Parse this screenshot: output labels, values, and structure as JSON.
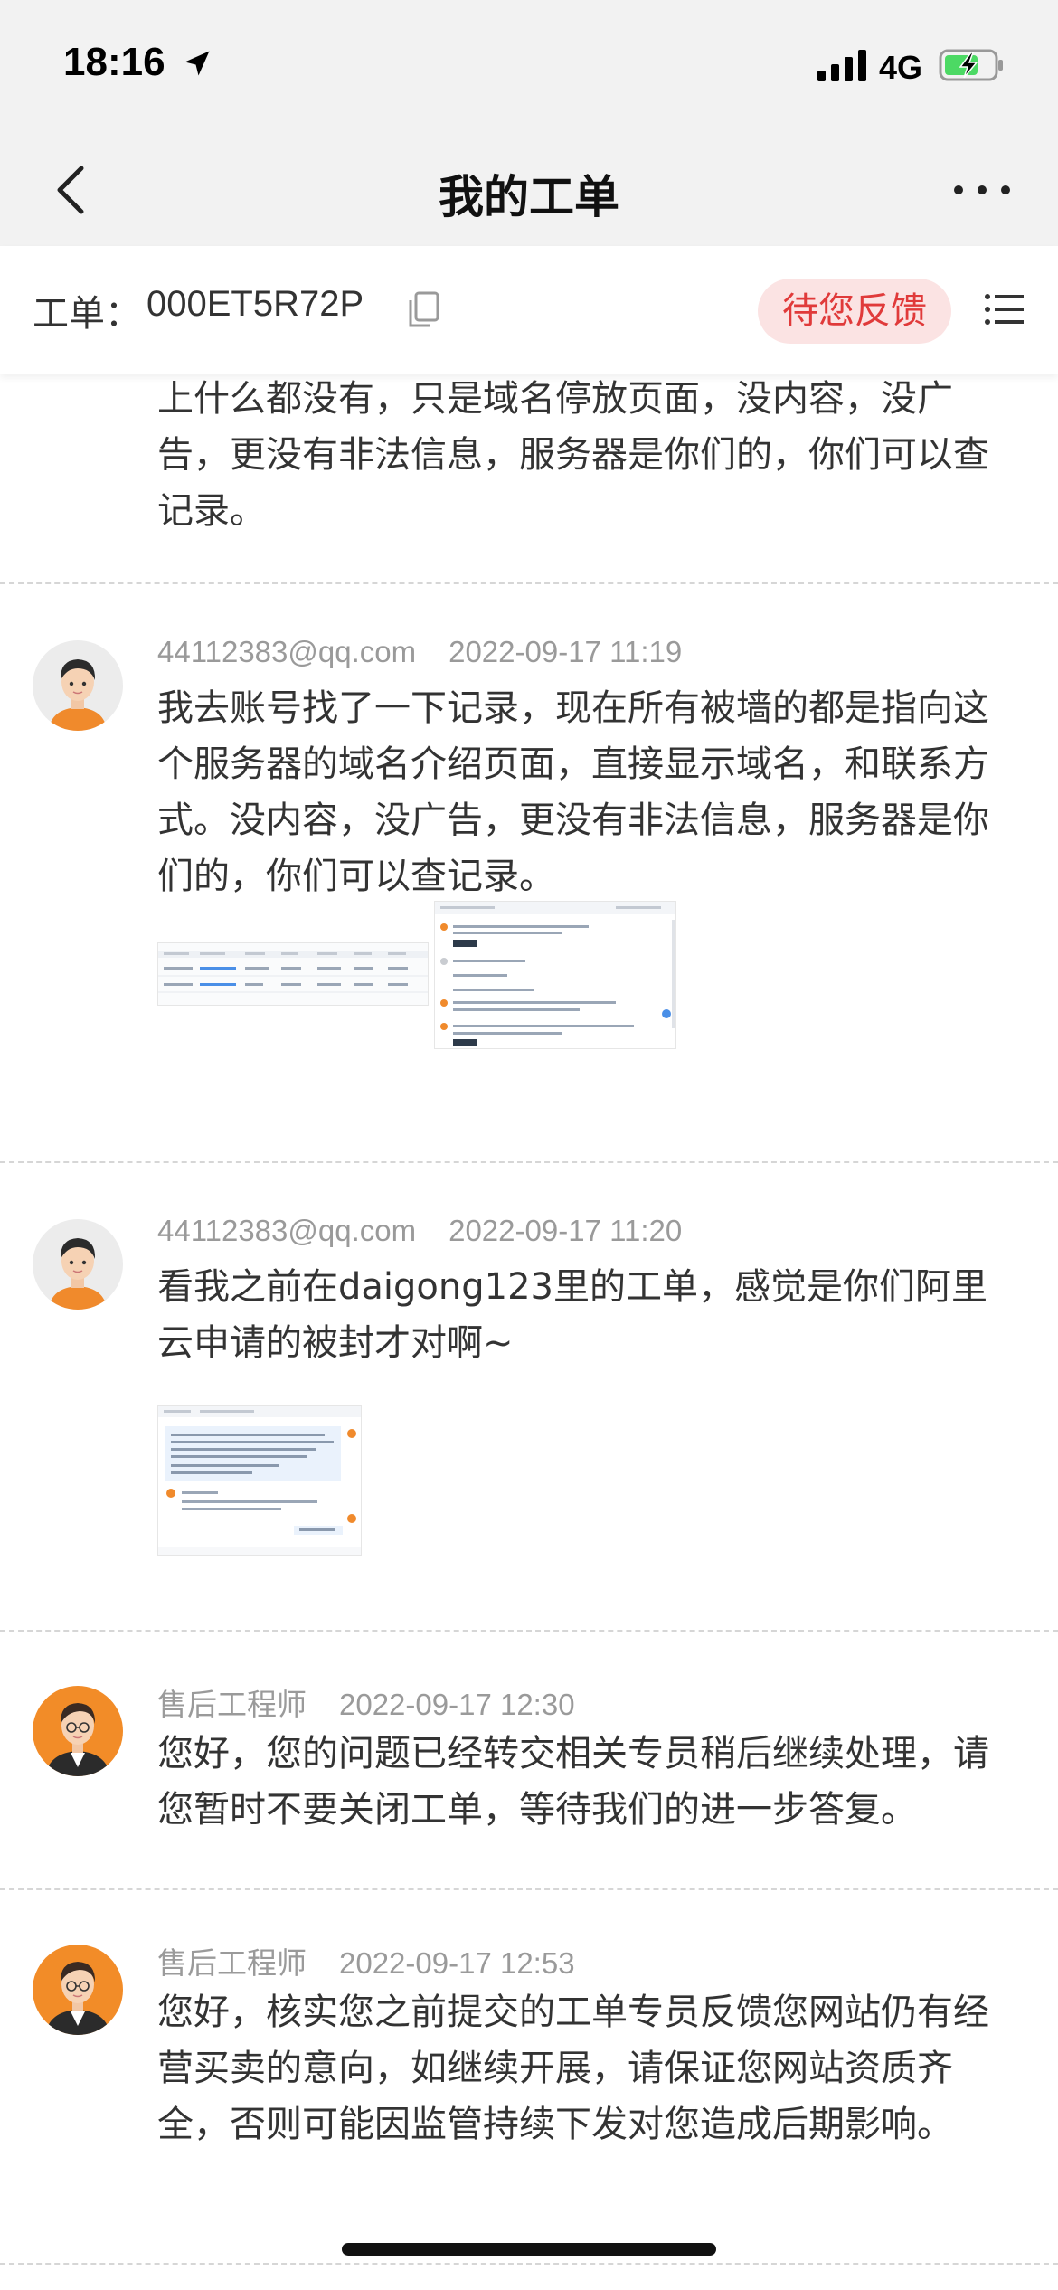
{
  "status_bar": {
    "time": "18:16",
    "network": "4G",
    "icons": [
      "location-arrow-icon",
      "signal-icon",
      "battery-charging-icon"
    ],
    "battery_color": "#4cd964"
  },
  "nav": {
    "title": "我的工单",
    "back_icon": "chevron-left-icon",
    "more_icon": "more-icon"
  },
  "ticket": {
    "label": "工单：",
    "id": "000ET5R72P",
    "status": "待您反馈",
    "status_color": "#e03a3a",
    "copy_icon": "copy-icon",
    "list_icon": "list-icon"
  },
  "messages": [
    {
      "partial": true,
      "body": "上什么都没有，只是域名停放页面，没内容，没广告，更没有非法信息，服务器是你们的，你们可以查记录。"
    },
    {
      "sender": "44112383@qq.com",
      "time": "2022-09-17 11:19",
      "avatar": "user-avatar",
      "body": "我去账号找了一下记录，现在所有被墙的都是指向这个服务器的域名介绍页面，直接显示域名，和联系方式。没内容，没广告，更没有非法信息，服务器是你们的，你们可以查记录。",
      "attachments": [
        "screenshot-thumbnail-table",
        "screenshot-thumbnail-chat"
      ]
    },
    {
      "sender": "44112383@qq.com",
      "time": "2022-09-17 11:20",
      "avatar": "user-avatar",
      "body": "看我之前在daigong123里的工单，感觉是你们阿里云申请的被封才对啊~",
      "attachments": [
        "screenshot-thumbnail-ticket"
      ]
    },
    {
      "sender": "售后工程师",
      "time": "2022-09-17 12:30",
      "avatar": "engineer-avatar",
      "body": "您好，您的问题已经转交相关专员稍后继续处理，请您暂时不要关闭工单，等待我们的进一步答复。"
    },
    {
      "sender": "售后工程师",
      "time": "2022-09-17 12:53",
      "avatar": "engineer-avatar",
      "body": "您好，核实您之前提交的工单专员反馈您网站仍有经营买卖的意向，如继续开展，请保证您网站资质齐全，否则可能因监管持续下发对您造成后期影响。"
    }
  ]
}
